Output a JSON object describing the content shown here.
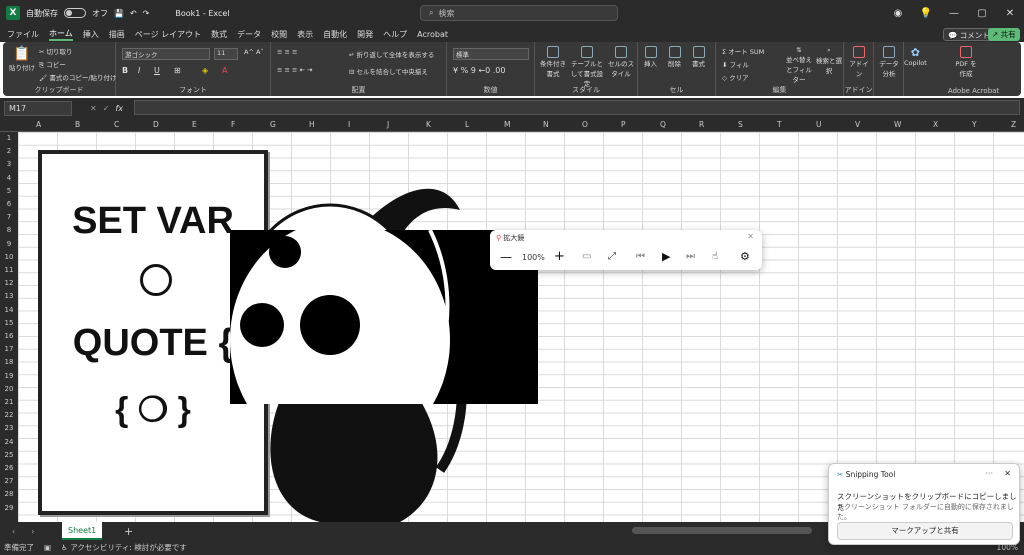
{
  "title": {
    "autosave_label": "自動保存",
    "toggle_label": "オフ",
    "file_name": "Book1 - Excel",
    "search_placeholder": "検索"
  },
  "menu": {
    "items": [
      "ファイル",
      "ホーム",
      "挿入",
      "描画",
      "ページ レイアウト",
      "数式",
      "データ",
      "校閲",
      "表示",
      "自動化",
      "開発",
      "ヘルプ",
      "Acrobat"
    ],
    "comment_btn": "コメント",
    "share_btn": "共有"
  },
  "ribbon": {
    "clipboard": {
      "label": "クリップボード",
      "paste": "貼り付け",
      "cut": "切り取り",
      "copy": "コピー",
      "format_painter": "書式のコピー/貼り付け"
    },
    "font": {
      "label": "フォント",
      "font_name": "游ゴシック",
      "font_size": "11"
    },
    "alignment": {
      "label": "配置",
      "wrap": "折り返して全体を表示する",
      "merge": "セルを結合して中央揃え"
    },
    "number": {
      "label": "数値",
      "format": "標準"
    },
    "styles": {
      "label": "スタイル",
      "cond": "条件付き書式",
      "table": "テーブルとして書式設定",
      "cell": "セルのスタイル"
    },
    "cells": {
      "label": "セル",
      "insert": "挿入",
      "delete": "削除",
      "format": "書式"
    },
    "editing": {
      "label": "編集",
      "autosum": "オート SUM",
      "fill": "フィル",
      "clear": "クリア",
      "sort": "並べ替えとフィルター",
      "find": "検索と選択"
    },
    "addins": {
      "label": "アドイン",
      "addin": "アドイン"
    },
    "analysis": {
      "label": "データ分析"
    },
    "copilot": {
      "label": "Copilot"
    },
    "acrobat": {
      "label": "Adobe Acrobat",
      "pdf": "PDF を作成"
    }
  },
  "formula_bar": {
    "name_box": "M17",
    "fx": "fx"
  },
  "columns": [
    "A",
    "B",
    "C",
    "D",
    "E",
    "F",
    "G",
    "H",
    "I",
    "J",
    "K",
    "L",
    "M",
    "N",
    "O",
    "P",
    "Q",
    "R",
    "S",
    "T",
    "U",
    "V",
    "W",
    "X",
    "Y",
    "Z"
  ],
  "rows": [
    "1",
    "2",
    "3",
    "4",
    "5",
    "6",
    "7",
    "8",
    "9",
    "10",
    "11",
    "12",
    "13",
    "14",
    "15",
    "16",
    "17",
    "18",
    "19",
    "20",
    "21",
    "22",
    "23",
    "24",
    "25",
    "26",
    "27",
    "28",
    "29"
  ],
  "poster": {
    "line1": "SET VAR",
    "line2": "QUOTE {",
    "line3": "{ ❍ }"
  },
  "magnifier": {
    "title": "拡大鏡",
    "zoom": "100%"
  },
  "sheets": {
    "tab": "Sheet1",
    "add": "+"
  },
  "status": {
    "ready": "準備完了",
    "accessibility": "アクセシビリティ: 検討が必要です",
    "zoom": "100%"
  },
  "toast": {
    "app": "Snipping Tool",
    "line1": "スクリーンショットをクリップボードにコピーしました",
    "line2": "スクリーンショット フォルダーに自動的に保存されました。",
    "button": "マークアップと共有"
  }
}
